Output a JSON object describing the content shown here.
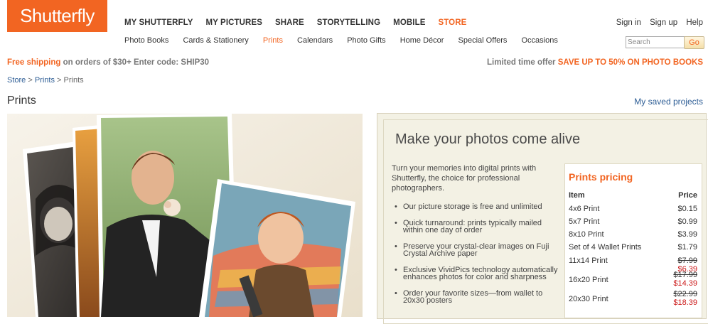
{
  "brand": {
    "logo_text": "Shutterfly",
    "accent": "#f26522",
    "link": "#2d5d95"
  },
  "main_nav": [
    "MY SHUTTERFLY",
    "MY PICTURES",
    "SHARE",
    "STORYTELLING",
    "MOBILE",
    "STORE"
  ],
  "top_links": [
    "Sign in",
    "Sign up",
    "Help"
  ],
  "sub_nav": [
    "Photo Books",
    "Cards & Stationery",
    "Prints",
    "Calendars",
    "Photo Gifts",
    "Home Décor",
    "Special Offers",
    "Occasions"
  ],
  "search": {
    "placeholder": "Search",
    "button": "Go"
  },
  "promo": {
    "left_em": "Free shipping",
    "left_rest": " on orders of $30+ Enter code: SHIP30",
    "right_lead": "Limited time offer ",
    "right_em": "SAVE UP TO 50% ON PHOTO BOOKS"
  },
  "breadcrumb": {
    "store": "Store",
    "prints": "Prints",
    "current": "Prints",
    "sep": " > "
  },
  "page_title": "Prints",
  "saved_link": "My saved projects",
  "panel": {
    "headline": "Make your photos come alive",
    "intro": "Turn your memories into digital prints with Shutterfly, the choice for professional photographers.",
    "features": [
      "Our picture storage is free and unlimited",
      "Quick turnaround: prints typically mailed within one day of order",
      "Preserve your crystal-clear images on Fuji Crystal Archive paper",
      "Exclusive VividPics technology automatically enhances photos for color and sharpness",
      "Order your favorite sizes—from wallet to 20x30 posters"
    ]
  },
  "pricing": {
    "title": "Prints pricing",
    "col_item": "Item",
    "col_price": "Price",
    "rows": [
      {
        "item": "4x6 Print",
        "price": "$0.15"
      },
      {
        "item": "5x7 Print",
        "price": "$0.99"
      },
      {
        "item": "8x10 Print",
        "price": "$3.99"
      },
      {
        "item": "Set of 4 Wallet Prints",
        "price": "$1.79"
      },
      {
        "item": "11x14 Print",
        "old": "$7.99",
        "sale": "$6.39"
      },
      {
        "item": "16x20 Print",
        "old": "$17.99",
        "sale": "$14.39"
      },
      {
        "item": "20x30 Print",
        "old": "$22.99",
        "sale": "$18.39"
      }
    ]
  }
}
